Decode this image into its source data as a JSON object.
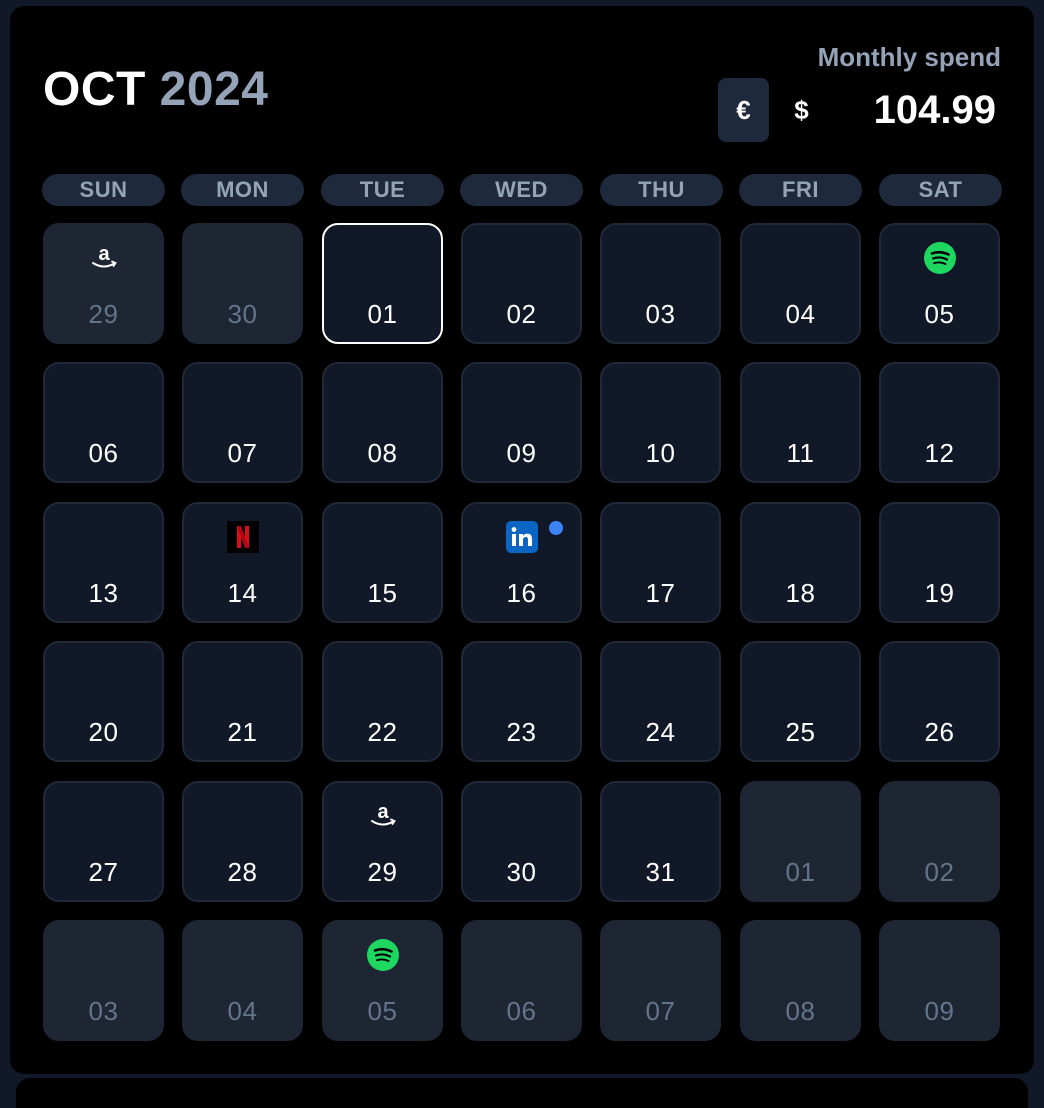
{
  "header": {
    "month": "OCT",
    "year": "2024",
    "spend_label": "Monthly spend",
    "spend_amount": "104.99",
    "currencies": [
      "€",
      "$"
    ],
    "selected_currency": "€"
  },
  "weekdays": [
    "SUN",
    "MON",
    "TUE",
    "WED",
    "THU",
    "FRI",
    "SAT"
  ],
  "days": [
    {
      "label": "29",
      "current_month": false,
      "icon": "amazon-icon"
    },
    {
      "label": "30",
      "current_month": false
    },
    {
      "label": "01",
      "current_month": true,
      "today": true
    },
    {
      "label": "02",
      "current_month": true
    },
    {
      "label": "03",
      "current_month": true
    },
    {
      "label": "04",
      "current_month": true
    },
    {
      "label": "05",
      "current_month": true,
      "icon": "spotify-icon"
    },
    {
      "label": "06",
      "current_month": true
    },
    {
      "label": "07",
      "current_month": true
    },
    {
      "label": "08",
      "current_month": true
    },
    {
      "label": "09",
      "current_month": true
    },
    {
      "label": "10",
      "current_month": true
    },
    {
      "label": "11",
      "current_month": true
    },
    {
      "label": "12",
      "current_month": true
    },
    {
      "label": "13",
      "current_month": true
    },
    {
      "label": "14",
      "current_month": true,
      "icon": "netflix-icon"
    },
    {
      "label": "15",
      "current_month": true
    },
    {
      "label": "16",
      "current_month": true,
      "icon": "linkedin-icon",
      "dot": true
    },
    {
      "label": "17",
      "current_month": true
    },
    {
      "label": "18",
      "current_month": true
    },
    {
      "label": "19",
      "current_month": true
    },
    {
      "label": "20",
      "current_month": true
    },
    {
      "label": "21",
      "current_month": true
    },
    {
      "label": "22",
      "current_month": true
    },
    {
      "label": "23",
      "current_month": true
    },
    {
      "label": "24",
      "current_month": true
    },
    {
      "label": "25",
      "current_month": true
    },
    {
      "label": "26",
      "current_month": true
    },
    {
      "label": "27",
      "current_month": true
    },
    {
      "label": "28",
      "current_month": true
    },
    {
      "label": "29",
      "current_month": true,
      "icon": "amazon-icon"
    },
    {
      "label": "30",
      "current_month": true
    },
    {
      "label": "31",
      "current_month": true
    },
    {
      "label": "01",
      "current_month": false
    },
    {
      "label": "02",
      "current_month": false
    },
    {
      "label": "03",
      "current_month": false
    },
    {
      "label": "04",
      "current_month": false
    },
    {
      "label": "05",
      "current_month": false,
      "icon": "spotify-icon"
    },
    {
      "label": "06",
      "current_month": false
    },
    {
      "label": "07",
      "current_month": false
    },
    {
      "label": "08",
      "current_month": false
    },
    {
      "label": "09",
      "current_month": false
    }
  ],
  "colors": {
    "accent_dot": "#3b82f6",
    "spotify": "#1ed760",
    "netflix": "#e50914",
    "linkedin": "#0a66c2"
  }
}
